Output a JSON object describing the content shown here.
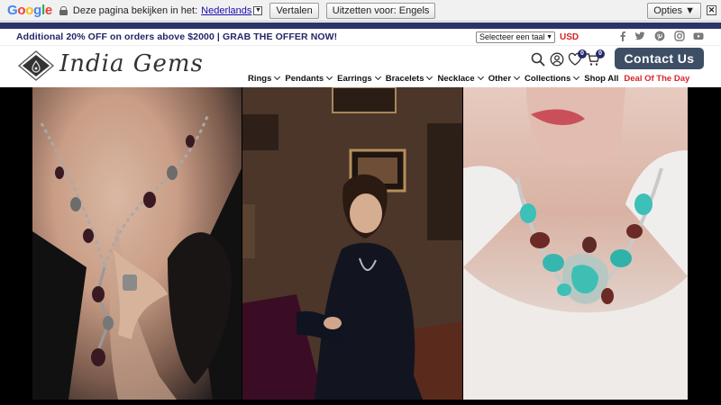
{
  "translate_bar": {
    "brand_letters": [
      "G",
      "o",
      "o",
      "g",
      "l",
      "e"
    ],
    "prompt": "Deze pagina bekijken in het:",
    "language": "Nederlands",
    "translate_button": "Vertalen",
    "turn_off_button": "Uitzetten voor: Engels",
    "options_button": "Opties ▼",
    "close_label": "✕"
  },
  "topbar": {
    "offer_text": "Additional 20% OFF on orders above $2000 | GRAB THE OFFER NOW!",
    "language_select": "Selecteer een taal",
    "currency": "USD",
    "social_icons": [
      "facebook-icon",
      "twitter-icon",
      "pinterest-icon",
      "instagram-icon",
      "youtube-icon"
    ]
  },
  "header": {
    "brand_name": "India Gems",
    "wishlist_count": "0",
    "cart_count": "0",
    "contact_button": "Contact Us"
  },
  "nav": {
    "items": [
      {
        "label": "Rings",
        "dropdown": true
      },
      {
        "label": "Pendants",
        "dropdown": true
      },
      {
        "label": "Earrings",
        "dropdown": true
      },
      {
        "label": "Bracelets",
        "dropdown": true
      },
      {
        "label": "Necklace",
        "dropdown": true
      },
      {
        "label": "Other",
        "dropdown": true
      },
      {
        "label": "Collections",
        "dropdown": true
      },
      {
        "label": "Shop All",
        "dropdown": false
      }
    ],
    "deal_label": "Deal Of The Day"
  },
  "colors": {
    "navy": "#25296b",
    "promo_bar": "#2c3467",
    "accent_red": "#d9232a",
    "contact_bg": "#3e4f65"
  }
}
